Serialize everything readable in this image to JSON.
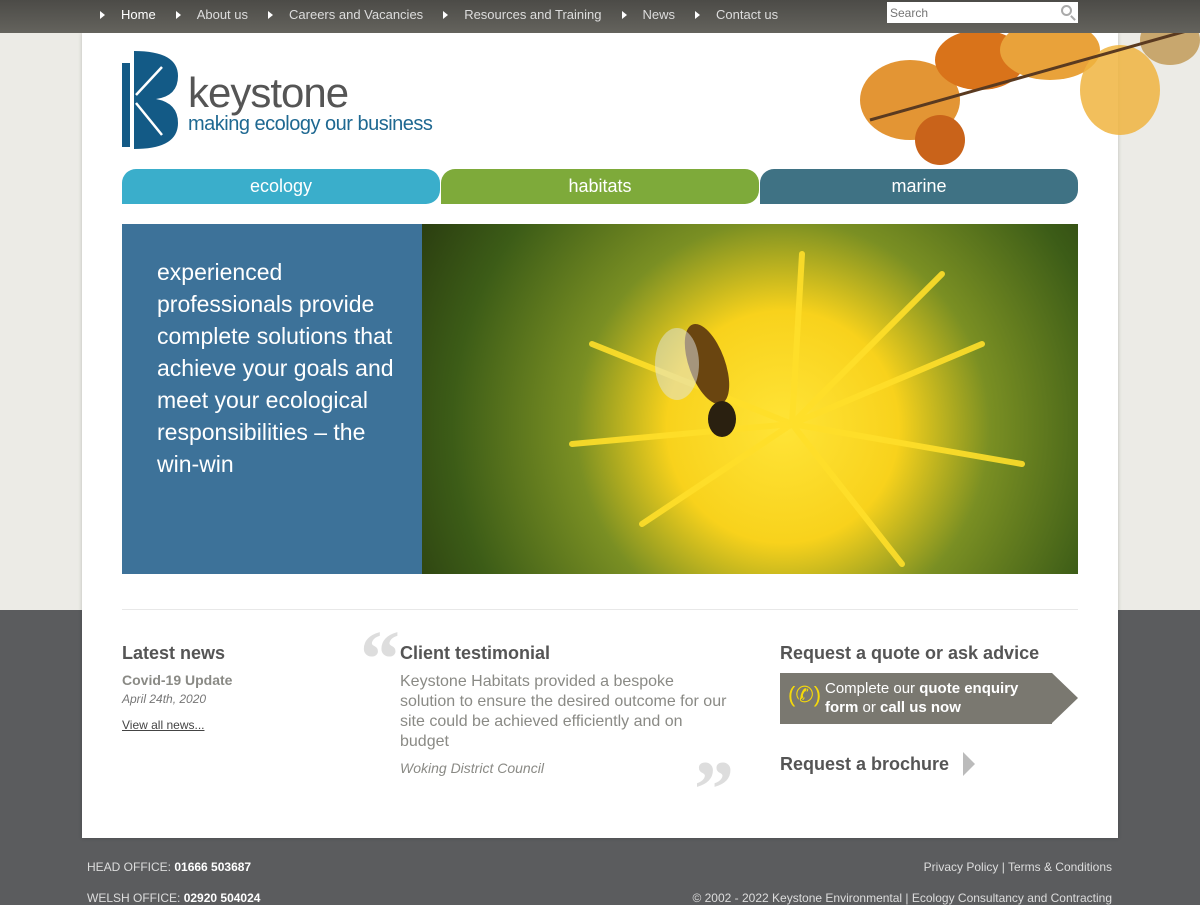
{
  "nav": {
    "items": [
      {
        "label": "Home",
        "active": true
      },
      {
        "label": "About us"
      },
      {
        "label": "Careers and Vacancies"
      },
      {
        "label": "Resources and Training"
      },
      {
        "label": "News"
      },
      {
        "label": "Contact us"
      }
    ],
    "search_placeholder": "Search"
  },
  "logo": {
    "word": "keystone",
    "tagline": "making ecology our business"
  },
  "tabs": [
    {
      "label": "ecology",
      "color": "#3aaecb"
    },
    {
      "label": "habitats",
      "color": "#7eaa3a"
    },
    {
      "label": "marine",
      "color": "#3f7284"
    }
  ],
  "hero": {
    "text": "experienced professionals provide complete solutions that achieve your goals and meet your ecological responsibilities – the win-win"
  },
  "news": {
    "heading": "Latest news",
    "title": "Covid-19 Update",
    "date": "April 24th, 2020",
    "link": "View all news..."
  },
  "testimonial": {
    "heading": "Client testimonial",
    "quote": "Keystone Habitats provided a bespoke solution to ensure the desired outcome for our site could be achieved efficiently and on budget",
    "author": "Woking District Council"
  },
  "quote": {
    "heading": "Request a quote or ask advice",
    "t1": "Complete our ",
    "b1": "quote enquiry form",
    "t2": " or ",
    "b2": "call us now",
    "brochure": "Request a brochure"
  },
  "footer": {
    "head_label": "HEAD OFFICE: ",
    "head_phone": "01666 503687",
    "welsh_label": "WELSH OFFICE: ",
    "welsh_phone": "02920 504024",
    "privacy": "Privacy Policy",
    "sep": "|",
    "terms": "Terms & Conditions",
    "copyright": "© 2002 - 2022 Keystone Environmental | Ecology Consultancy and Contracting"
  }
}
